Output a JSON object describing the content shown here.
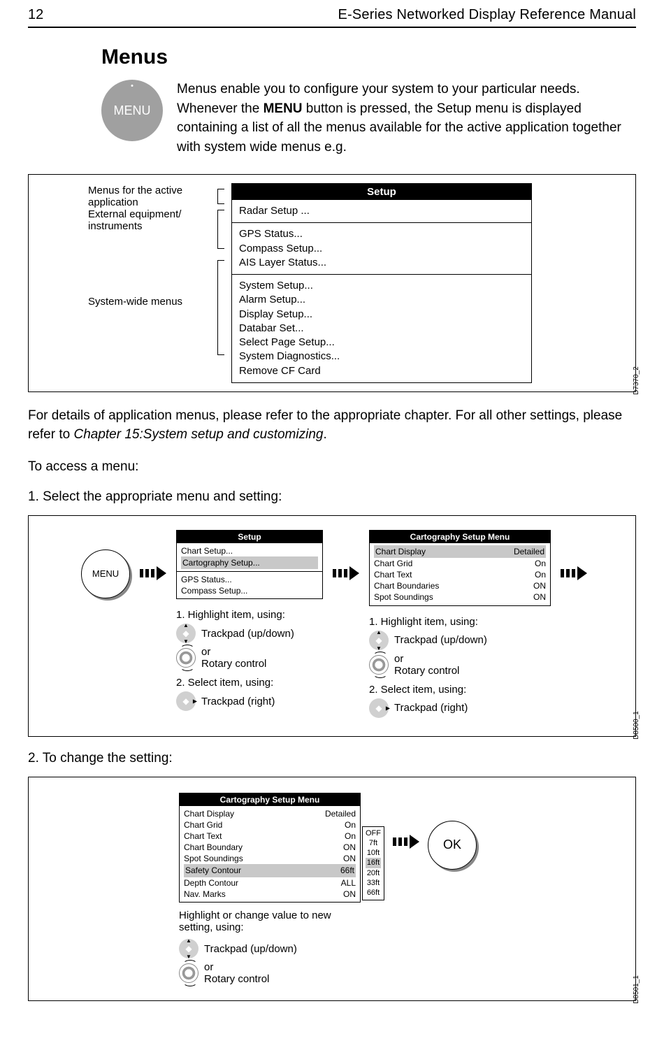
{
  "header": {
    "page_number": "12",
    "document_title": "E-Series Networked Display Reference Manual"
  },
  "section": {
    "title": "Menus",
    "intro_a": "Menus enable you to configure your system to your particular needs. Whenever the ",
    "intro_b": "MENU",
    "intro_c": " button is pressed, the Setup menu is displayed containing a list of all the menus available for the active application together with system wide menus e.g.",
    "menu_button_label": "MENU"
  },
  "figure1": {
    "id": "D7370_2",
    "labels": {
      "active": "Menus for the active application",
      "external": "External equipment/ instruments",
      "system": "System-wide menus"
    },
    "panel": {
      "title": "Setup",
      "g1": [
        "Radar Setup ..."
      ],
      "g2": [
        "GPS Status...",
        "Compass Setup...",
        "AIS Layer Status..."
      ],
      "g3": [
        "System Setup...",
        "Alarm Setup...",
        "Display Setup...",
        "Databar Set...",
        "Select Page Setup...",
        "System Diagnostics...",
        "Remove CF Card"
      ]
    }
  },
  "after_fig1": {
    "para_a": "For details of application menus, please refer to the appropriate chapter. For all other settings, please refer to ",
    "para_b": "Chapter 15:System setup and customizing",
    "para_c": ".",
    "access": "To access a menu:",
    "step1": "1.   Select the appropriate menu and setting:"
  },
  "figure2": {
    "id": "D8500_1",
    "menu_label": "MENU",
    "panel_a": {
      "title": "Setup",
      "r1": "Chart Setup...",
      "r2": "Cartography Setup...",
      "r3": "GPS Status...",
      "r4": "Compass Setup..."
    },
    "panel_b": {
      "title": "Cartography Setup Menu",
      "rows": [
        {
          "k": "Chart Display",
          "v": "Detailed"
        },
        {
          "k": "Chart Grid",
          "v": "On"
        },
        {
          "k": "Chart Text",
          "v": "On"
        },
        {
          "k": "Chart Boundaries",
          "v": "ON"
        },
        {
          "k": "Spot Soundings",
          "v": "ON"
        }
      ]
    },
    "instr": {
      "h1": "1.  Highlight item, using:",
      "tp_ud": "Trackpad (up/down)",
      "or": "or",
      "rotary": "Rotary control",
      "h2": "2.  Select item, using:",
      "tp_r": "Trackpad (right)"
    }
  },
  "step2": "2.   To change the setting:",
  "figure3": {
    "id": "D8501_1",
    "panel": {
      "title": "Cartography Setup Menu",
      "rows": [
        {
          "k": "Chart Display",
          "v": "Detailed"
        },
        {
          "k": "Chart Grid",
          "v": "On"
        },
        {
          "k": "Chart Text",
          "v": "On"
        },
        {
          "k": "Chart Boundary",
          "v": "ON"
        },
        {
          "k": "Spot Soundings",
          "v": "ON"
        },
        {
          "k": "Safety Contour",
          "v": "66ft"
        },
        {
          "k": "Depth Contour",
          "v": "ALL"
        },
        {
          "k": "Nav. Marks",
          "v": "ON"
        }
      ]
    },
    "options": [
      "OFF",
      "7ft",
      "10ft",
      "16ft",
      "20ft",
      "33ft",
      "66ft"
    ],
    "instr_text": "Highlight or change value to new setting, using:",
    "tp_ud": "Trackpad (up/down)",
    "or": "or",
    "rotary": "Rotary control",
    "ok": "OK"
  }
}
